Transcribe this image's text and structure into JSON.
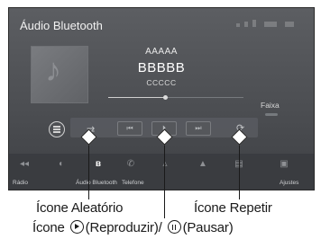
{
  "screen": {
    "title": "Áudio Bluetooth",
    "track": {
      "line1": "AAAAA",
      "line2": "BBBBB",
      "line3": "CCCCC"
    },
    "progress_fraction": 0.42,
    "faixa_label": "Faixa"
  },
  "controls": [
    {
      "name": "menu-icon"
    },
    {
      "name": "shuffle-icon"
    },
    {
      "name": "skip-back-icon",
      "glyph": "⏮"
    },
    {
      "name": "play-pause-icon",
      "glyph": "⏵"
    },
    {
      "name": "skip-forward-icon",
      "glyph": "⏭"
    },
    {
      "name": "repeat-icon"
    }
  ],
  "bottom_tabs": {
    "radio_label": "Rádio",
    "bluetooth_label": "Áudio Bluetooth",
    "phone_label": "Telefone",
    "settings_label": "Ajustes"
  },
  "callouts": {
    "shuffle": "Ícone Aleatório",
    "repeat": "Ícone Repetir",
    "play_prefix": "Ícone",
    "play_middle": "(Reproduzir)/",
    "play_suffix": "(Pausar)"
  },
  "colors": {
    "screen_bg": "#4c4e52",
    "text": "#1a1a1a",
    "screen_text": "#ffffff"
  }
}
